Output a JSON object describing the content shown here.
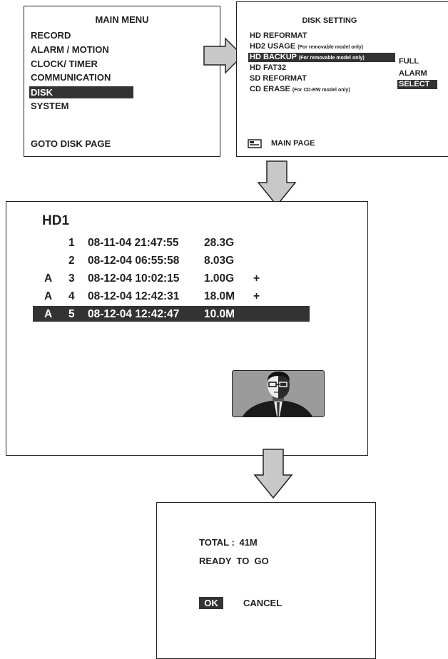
{
  "main_menu": {
    "title": "MAIN  MENU",
    "items": [
      "RECORD",
      "ALARM / MOTION",
      "CLOCK/ TIMER",
      "COMMUNICATION",
      "DISK",
      "SYSTEM"
    ],
    "selected_item": "DISK",
    "footer": "GOTO DISK PAGE"
  },
  "disk_setting": {
    "title": "DISK SETTING",
    "items": [
      {
        "label": "HD REFORMAT",
        "note": ""
      },
      {
        "label": "HD2 USAGE",
        "note": "(For removable model only)"
      },
      {
        "label": "HD BACKUP",
        "note": "(For removable model only)"
      },
      {
        "label": "HD FAT32",
        "note": ""
      },
      {
        "label": "SD REFORMAT",
        "note": ""
      },
      {
        "label": "CD ERASE",
        "note": "(For CD-RW model only)"
      }
    ],
    "selected_item": "HD BACKUP",
    "backup_options": [
      "FULL",
      "ALARM",
      "SELECT"
    ],
    "selected_option": "SELECT",
    "footer": "MAIN PAGE"
  },
  "backup_list": {
    "title": "HD1",
    "rows": [
      {
        "flag": "",
        "num": "1",
        "datetime": "08-11-04 21:47:55",
        "size": "28.3G",
        "mark": ""
      },
      {
        "flag": "",
        "num": "2",
        "datetime": "08-12-04 06:55:58",
        "size": "8.03G",
        "mark": ""
      },
      {
        "flag": "A",
        "num": "3",
        "datetime": "08-12-04 10:02:15",
        "size": "1.00G",
        "mark": "+"
      },
      {
        "flag": "A",
        "num": "4",
        "datetime": "08-12-04 12:42:31",
        "size": "18.0M",
        "mark": "+"
      },
      {
        "flag": "A",
        "num": "5",
        "datetime": "08-12-04 12:42:47",
        "size": "10.0M",
        "mark": ""
      }
    ],
    "selected_row": 5
  },
  "confirm": {
    "total_label": "TOTAL :",
    "total_value": "41M",
    "status": "READY  TO  GO",
    "ok_label": "OK",
    "cancel_label": "CANCEL"
  },
  "colors": {
    "highlight": "#333333",
    "arrow_fill": "#c8c8c8"
  }
}
